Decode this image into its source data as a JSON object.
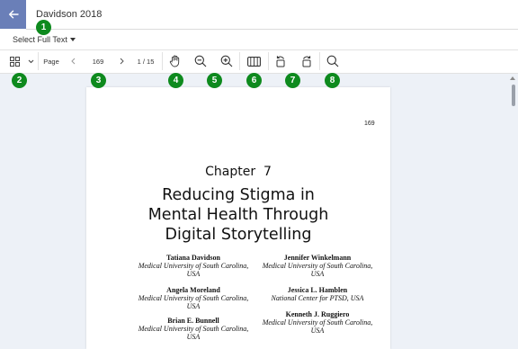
{
  "header": {
    "title": "Davidson 2018",
    "select_text": "Select Full Text"
  },
  "toolbar": {
    "page_label": "Page",
    "page_value": "169",
    "page_count": "1 / 15"
  },
  "badges": [
    "1",
    "2",
    "3",
    "4",
    "5",
    "6",
    "7",
    "8"
  ],
  "document": {
    "page_number": "169",
    "chapter": "Chapter  7",
    "title_lines": [
      "Reducing Stigma in",
      "Mental Health Through",
      "Digital Storytelling"
    ],
    "authors": [
      {
        "name": "Tatiana Davidson",
        "aff1": "Medical University of South Carolina,",
        "aff2": "USA"
      },
      {
        "name": "Jennifer Winkelmann",
        "aff1": "Medical University of South Carolina,",
        "aff2": "USA"
      },
      {
        "name": "Angela Moreland",
        "aff1": "Medical University of South Carolina,",
        "aff2": "USA"
      },
      {
        "name": "Jessica L. Hamblen",
        "aff1": "National Center for PTSD, USA",
        "aff2": ""
      },
      {
        "name": "Brian E. Bunnell",
        "aff1": "Medical University of South Carolina,",
        "aff2": "USA"
      },
      {
        "name": "Kenneth J. Ruggiero",
        "aff1": "Medical University of South Carolina,",
        "aff2": "USA"
      }
    ]
  },
  "colors": {
    "back_button": "#6a7fb8",
    "badge": "#0e8a1e",
    "viewer_background": "#edf1f7"
  },
  "icons": [
    "arrow-left-icon",
    "grid-icon",
    "chevron-down-icon",
    "chevron-left-icon",
    "chevron-right-icon",
    "hand-pan-icon",
    "zoom-out-icon",
    "zoom-in-icon",
    "two-page-icon",
    "rotate-counterclockwise-icon",
    "rotate-clockwise-icon",
    "search-icon"
  ]
}
